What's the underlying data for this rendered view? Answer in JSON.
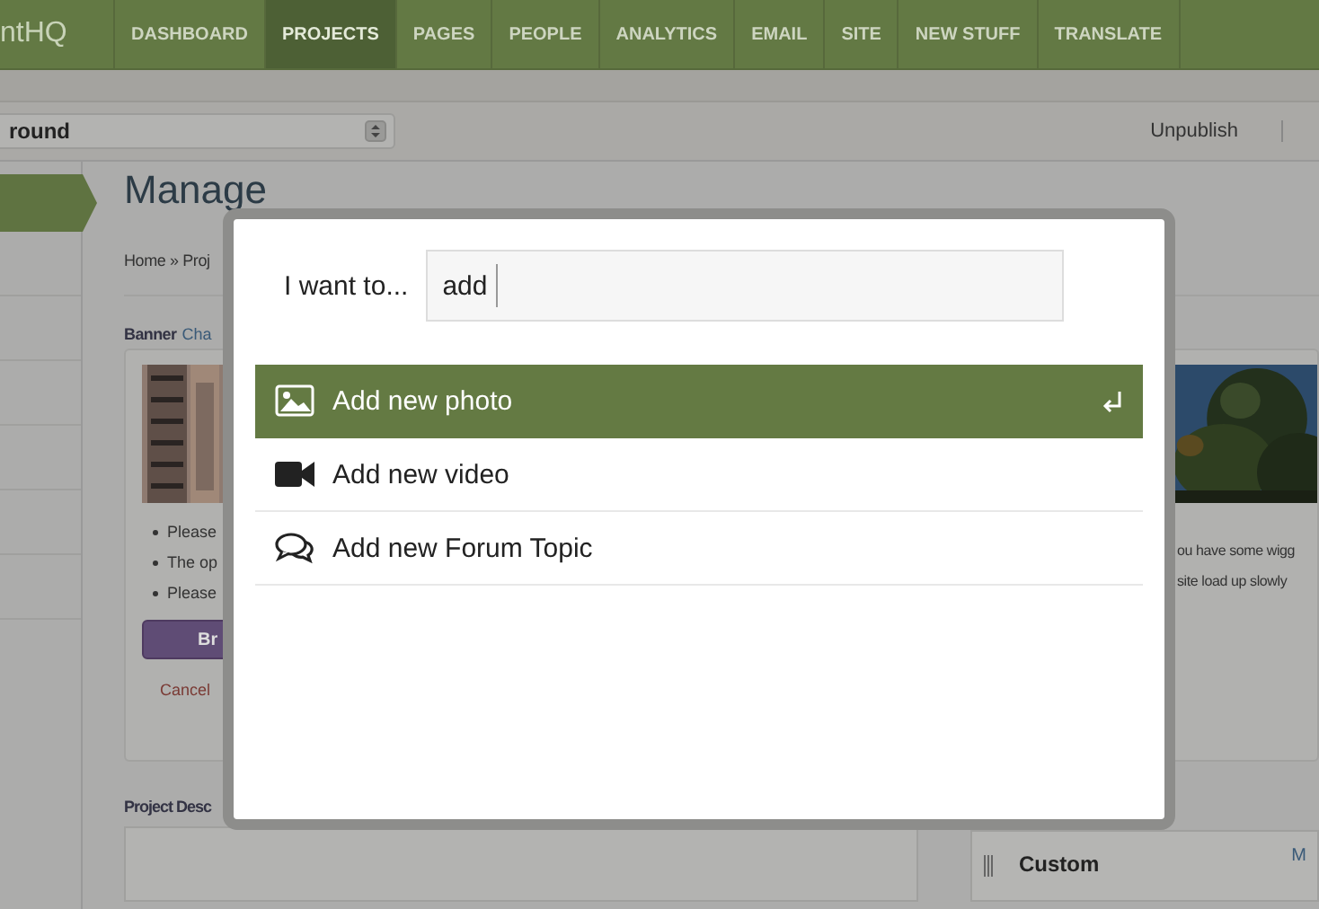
{
  "app": {
    "logo": "ntHQ",
    "nav": [
      {
        "label": "DASHBOARD",
        "selected": false
      },
      {
        "label": "PROJECTS",
        "selected": true
      },
      {
        "label": "PAGES",
        "selected": false
      },
      {
        "label": "PEOPLE",
        "selected": false
      },
      {
        "label": "ANALYTICS",
        "selected": false
      },
      {
        "label": "EMAIL",
        "selected": false
      },
      {
        "label": "SITE",
        "selected": false
      },
      {
        "label": "NEW STUFF",
        "selected": false
      },
      {
        "label": "TRANSLATE",
        "selected": false
      }
    ]
  },
  "toolbar": {
    "select_value": "round",
    "actions": [
      "Unpublish"
    ]
  },
  "page": {
    "title": "Manage",
    "breadcrumb": "Home » Proj",
    "banner": {
      "label": "Banner",
      "link": "Cha",
      "notes": [
        "Please",
        "The op",
        "Please"
      ],
      "button": "Br",
      "cancel": "Cancel"
    },
    "right_notes": [
      "ou have some wigg",
      "site load up slowly"
    ],
    "description_label": "Project Desc",
    "custom": {
      "title": "Custom",
      "link": "M"
    }
  },
  "dialog": {
    "label": "I want to...",
    "query": "add",
    "results": [
      {
        "label": "Add new photo",
        "selected": true
      },
      {
        "label": "Add new video",
        "kind": "video",
        "selected": false
      },
      {
        "label": "Add new Forum Topic",
        "kind": "forum",
        "selected": false
      }
    ]
  }
}
